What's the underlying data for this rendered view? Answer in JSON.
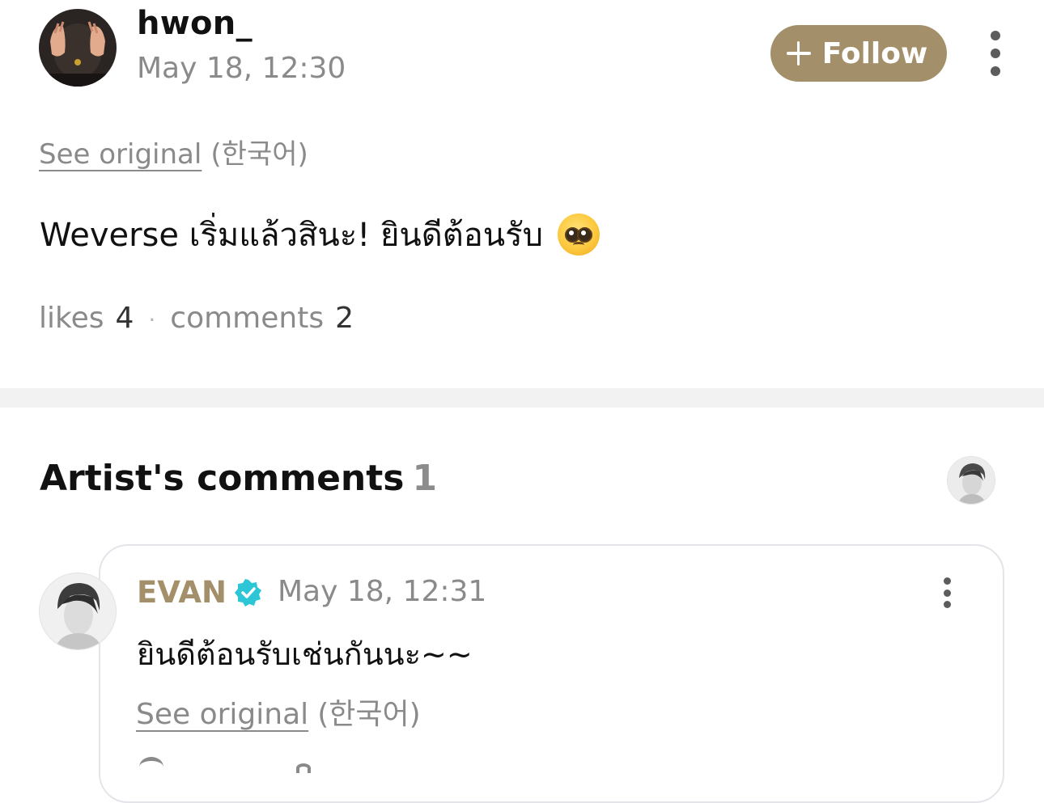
{
  "post": {
    "author": "hwon_",
    "date": "May 18, 12:30",
    "follow_label": "Follow",
    "see_original": "See original",
    "original_language": "(한국어)",
    "body": "Weverse เริ่มแล้วสินะ! ยินดีต้อนรับ",
    "emoji": "pleading-face-emoji",
    "stats": {
      "likes_label": "likes",
      "likes_count": "4",
      "separator": "·",
      "comments_label": "comments",
      "comments_count": "2"
    }
  },
  "artist_comments": {
    "title": "Artist's comments",
    "count": "1",
    "comments": [
      {
        "author": "EVAN",
        "verified": true,
        "date": "May 18, 12:31",
        "body": "ยินดีต้อนรับเช่นกันนะ~~",
        "see_original": "See original",
        "original_language": "(한국어)"
      }
    ]
  },
  "colors": {
    "accent": "#a3906a",
    "verified": "#2cc6d6",
    "muted_text": "#8a8a8a",
    "divider": "#f2f2f2"
  },
  "icons": [
    "plus-icon",
    "more-vertical-icon",
    "verified-badge-icon",
    "pleading-face-emoji"
  ]
}
